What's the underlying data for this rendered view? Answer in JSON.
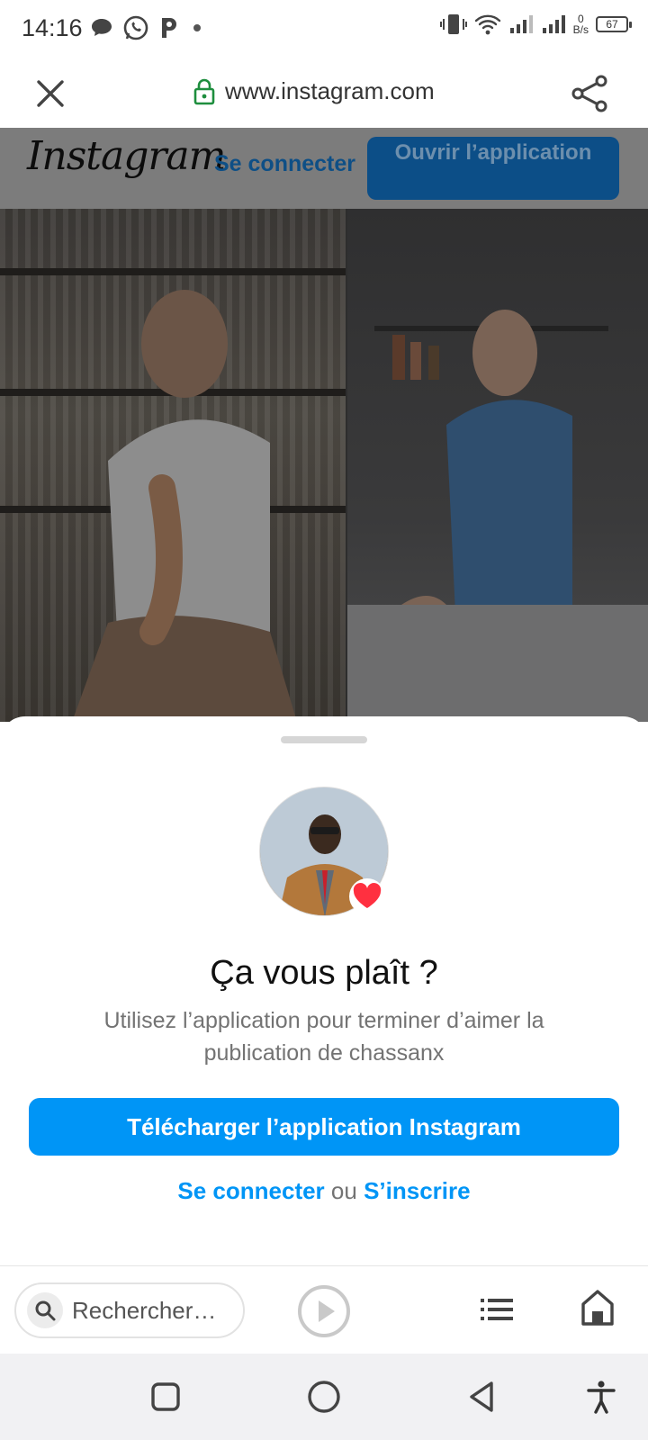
{
  "status_bar": {
    "time": "14:16",
    "net_speed_value": "0",
    "net_speed_unit": "B/s",
    "battery": "67",
    "icons": [
      "chat-bubble-icon",
      "whatsapp-icon",
      "p-app-icon",
      "dot-icon",
      "vibrate-icon",
      "wifi-icon",
      "signal-icon",
      "signal-icon"
    ]
  },
  "url_bar": {
    "url": "www.instagram.com",
    "secure": true,
    "icons": [
      "close-icon",
      "lock-icon",
      "share-icon"
    ]
  },
  "page": {
    "logo_text": "Instagram",
    "login_link": "Se connecter",
    "open_app_button": "Ouvrir l’application"
  },
  "sheet": {
    "title": "Ça vous plaît ?",
    "subtitle": "Utilisez l’application pour terminer d’aimer la publication de chassanx",
    "download_button": "Télécharger l’application Instagram",
    "login_link": "Se connecter",
    "or_text": "ou",
    "signup_link": "S’inscrire",
    "heart_color": "#ff3040"
  },
  "browser_toolbar": {
    "search_placeholder": "Rechercher…",
    "icons": [
      "search-icon",
      "play-icon",
      "menu-icon",
      "home-icon"
    ]
  },
  "nav_bar": {
    "icons": [
      "recent-apps-icon",
      "home-circle-icon",
      "back-icon",
      "accessibility-icon"
    ]
  },
  "colors": {
    "accent": "#0095f6",
    "dim_header": "#7c7c7c",
    "open_app_bg": "#0c4e87"
  }
}
